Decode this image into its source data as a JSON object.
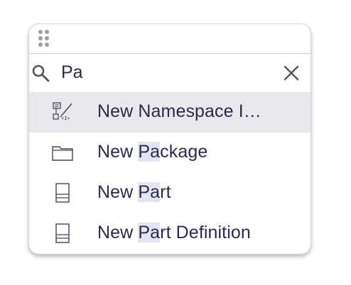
{
  "search": {
    "value": "Pa",
    "placeholder": ""
  },
  "items": [
    {
      "prefix": "New ",
      "match": "",
      "suffix": "Namespace I…",
      "icon": "namespace-import-icon",
      "selected": true
    },
    {
      "prefix": "New ",
      "match": "Pa",
      "suffix": "ckage",
      "icon": "folder-icon",
      "selected": false
    },
    {
      "prefix": "New ",
      "match": "Pa",
      "suffix": "rt",
      "icon": "part-icon",
      "selected": false
    },
    {
      "prefix": "New ",
      "match": "Pa",
      "suffix": "rt Definition",
      "icon": "part-definition-icon",
      "selected": false
    }
  ],
  "colors": {
    "text": "#2b2b4d",
    "icon": "#454560",
    "selected_row": "#e8e8ed",
    "match_highlight": "#e4e4f3"
  }
}
